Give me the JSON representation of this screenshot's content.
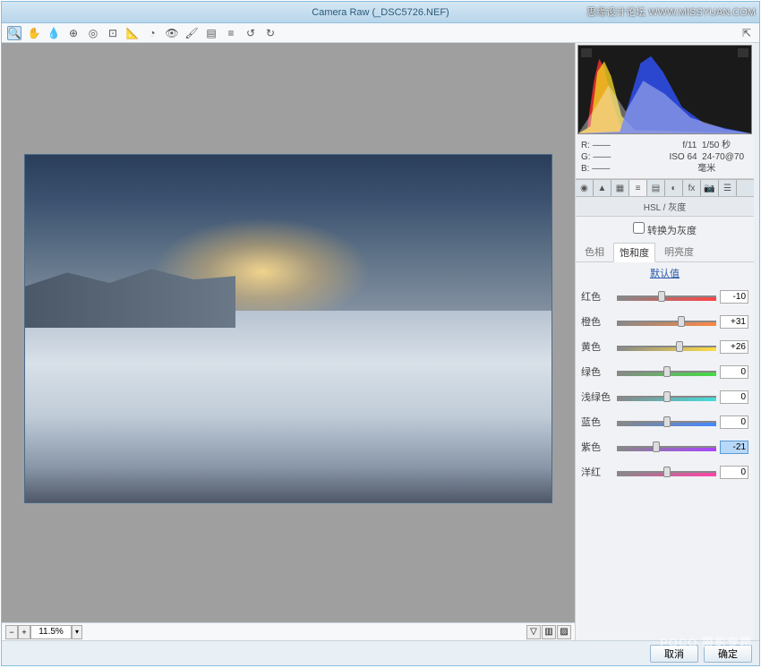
{
  "window": {
    "title": "Camera Raw (_DSC5726.NEF)"
  },
  "watermark_top": "思缘设计论坛  WWW.MISSYUAN.COM",
  "watermark_bottom": "POCO 摄影专题",
  "zoom": {
    "value": "11.5%"
  },
  "info": {
    "r": "R: ——",
    "g": "G: ——",
    "b": "B: ——",
    "aperture": "f/11",
    "shutter": "1/50 秒",
    "iso": "ISO 64",
    "lens": "24-70@70 毫米"
  },
  "panel": {
    "title": "HSL / 灰度",
    "grayscale_label": "转换为灰度",
    "subtabs": {
      "hue": "色相",
      "sat": "饱和度",
      "lum": "明亮度"
    },
    "default_link": "默认值"
  },
  "sliders": {
    "red": {
      "label": "红色",
      "value": "-10",
      "pos": 45
    },
    "orange": {
      "label": "橙色",
      "value": "+31",
      "pos": 65
    },
    "yellow": {
      "label": "黄色",
      "value": "+26",
      "pos": 63
    },
    "green": {
      "label": "绿色",
      "value": "0",
      "pos": 50
    },
    "aqua": {
      "label": "浅绿色",
      "value": "0",
      "pos": 50
    },
    "blue": {
      "label": "蓝色",
      "value": "0",
      "pos": 50
    },
    "purple": {
      "label": "紫色",
      "value": "-21",
      "pos": 40
    },
    "magenta": {
      "label": "洋红",
      "value": "0",
      "pos": 50
    }
  },
  "buttons": {
    "cancel": "取消",
    "ok": "确定"
  }
}
